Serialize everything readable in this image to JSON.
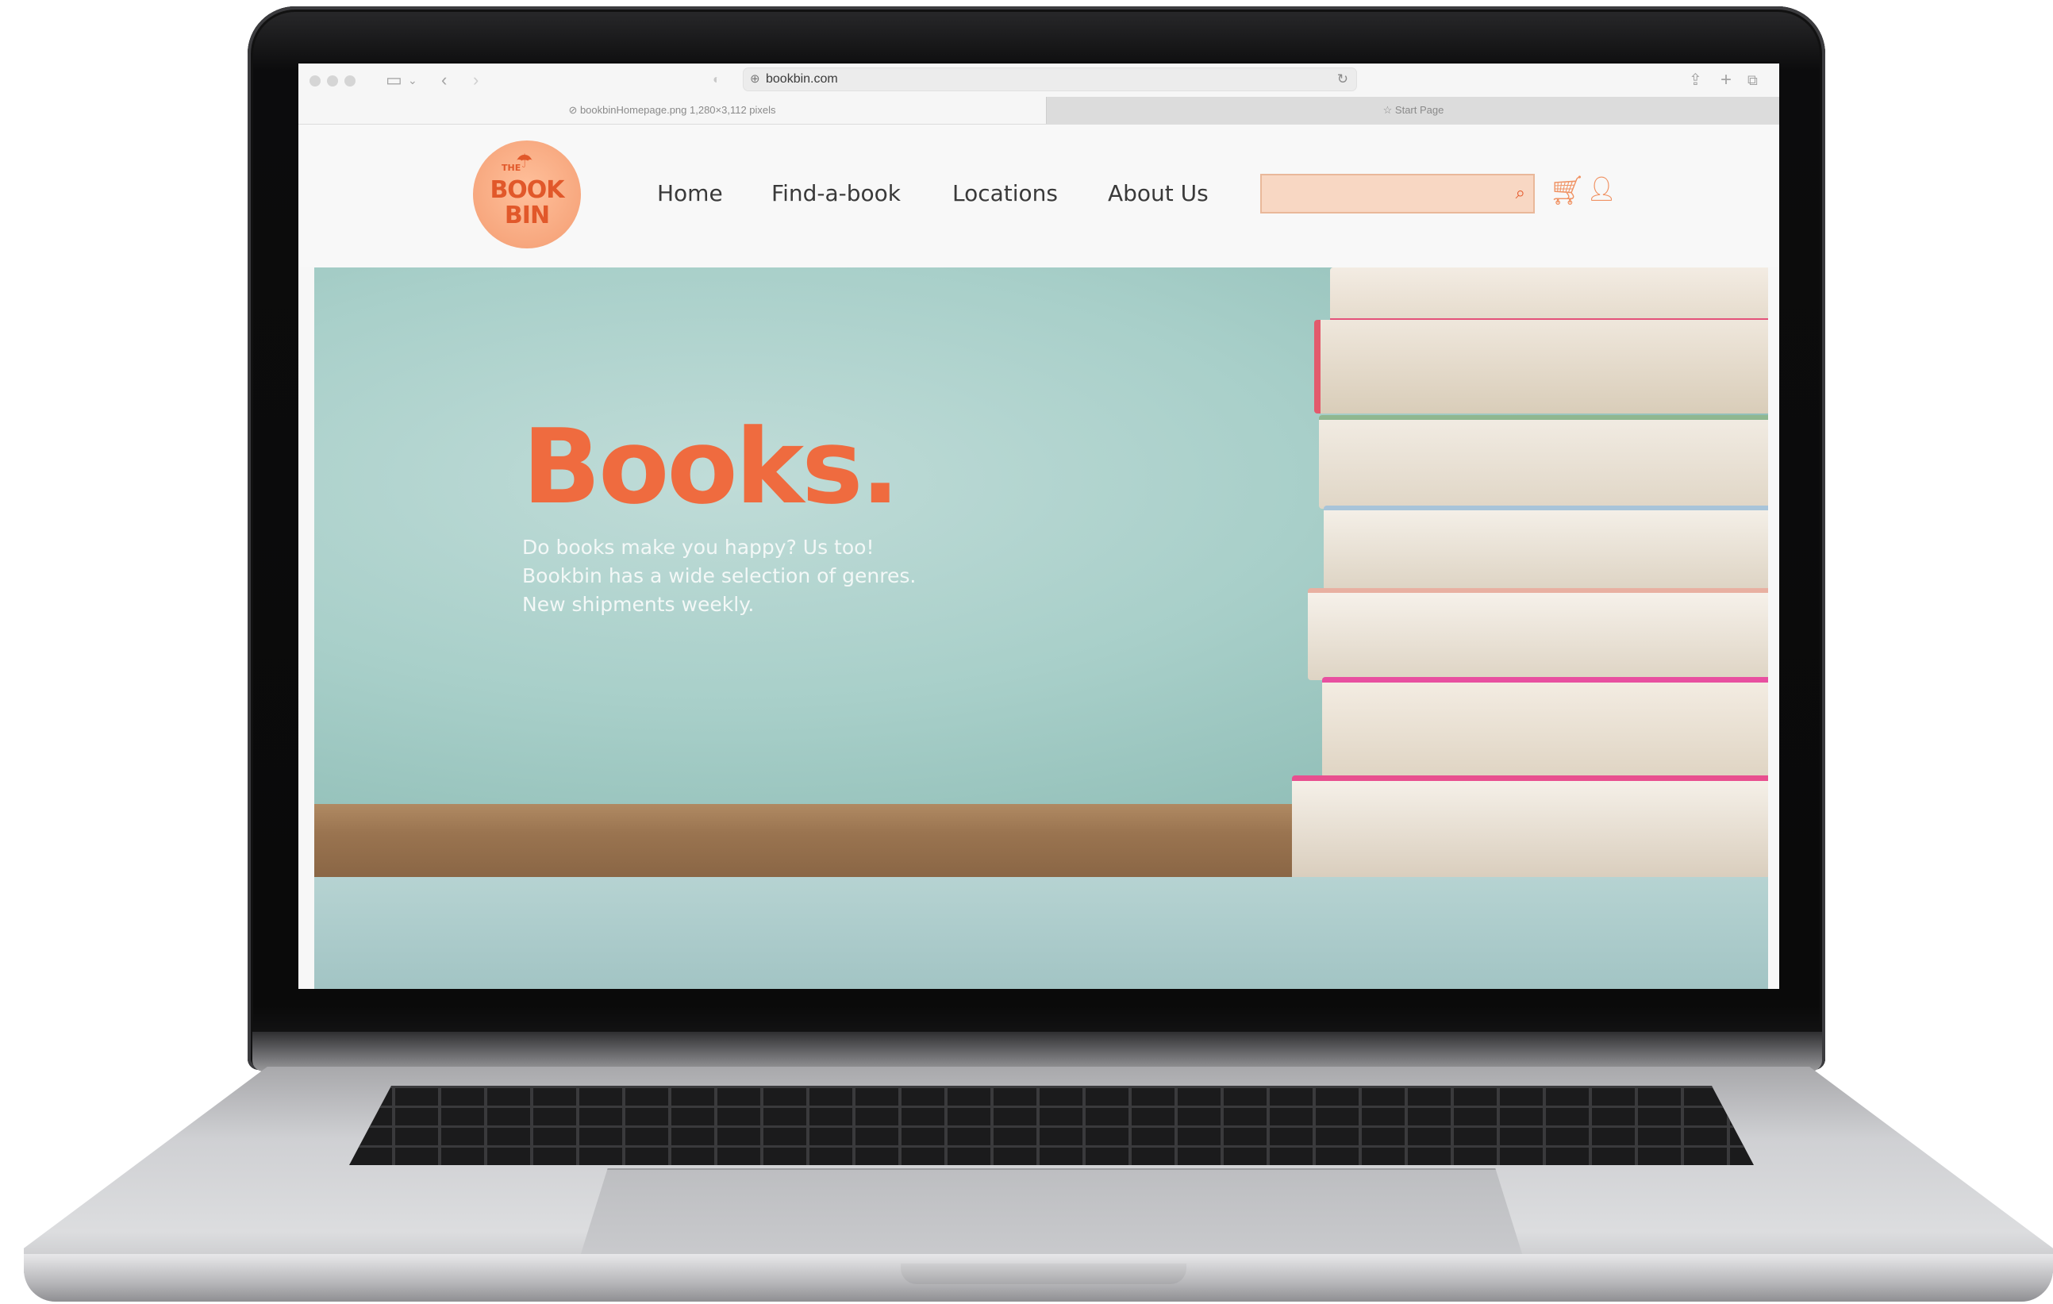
{
  "browser": {
    "url": "bookbin.com",
    "tabs": [
      {
        "label": "bookbinHomepage.png 1,280×3,112 pixels",
        "active": true
      },
      {
        "label": "Start Page",
        "active": false
      }
    ]
  },
  "site": {
    "logo": {
      "the": "THE",
      "line1": "BOOK",
      "line2": "BIN"
    },
    "nav": [
      "Home",
      "Find-a-book",
      "Locations",
      "About Us"
    ],
    "search": {
      "placeholder": "",
      "value": ""
    }
  },
  "hero": {
    "title": "Books.",
    "lines": [
      "Do books make you happy? Us too!",
      "Bookbin has a wide selection of genres.",
      "New shipments weekly."
    ]
  },
  "colors": {
    "accent": "#ef6b3f",
    "search_bg": "#f8d7c3",
    "icon_orange": "#f09263",
    "hero_teal": "#a8cfc9"
  }
}
